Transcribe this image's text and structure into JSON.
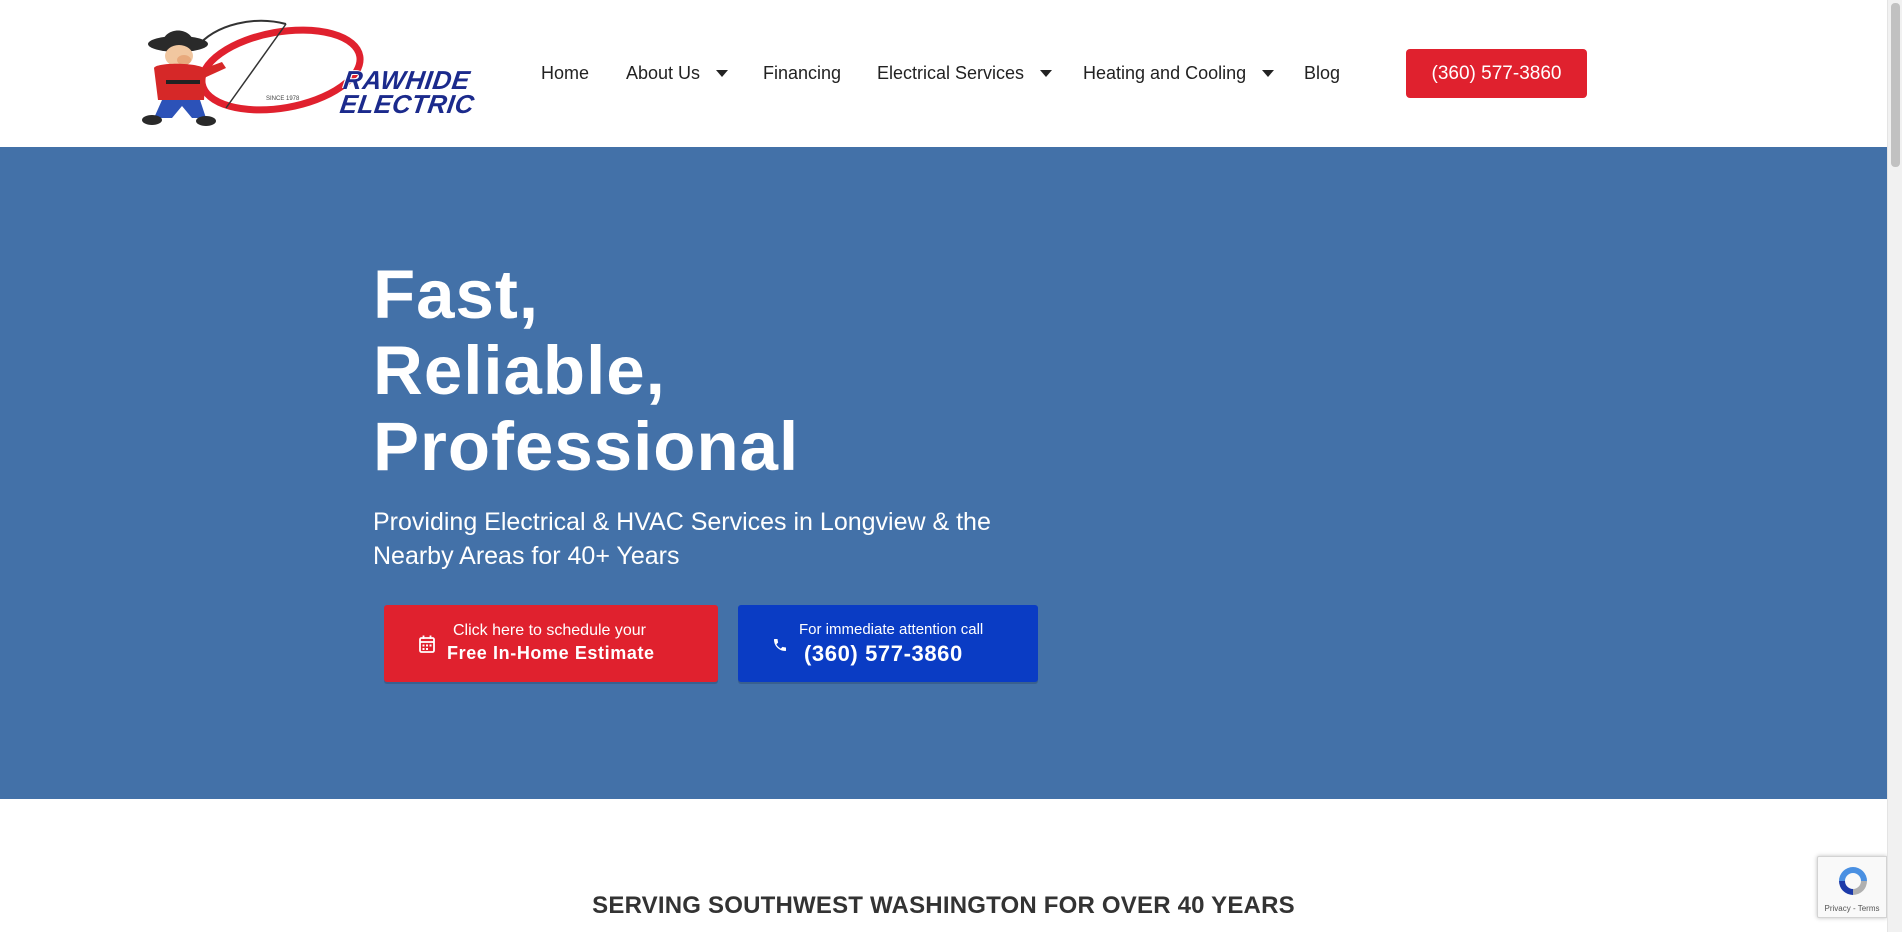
{
  "brand": {
    "logo_line1": "RAWHIDE",
    "logo_line2": "ELECTRIC",
    "logo_since": "SINCE 1978"
  },
  "nav": {
    "items": [
      {
        "label": "Home",
        "has_dropdown": false
      },
      {
        "label": "About Us",
        "has_dropdown": true
      },
      {
        "label": "Financing",
        "has_dropdown": false
      },
      {
        "label": "Electrical Services",
        "has_dropdown": true
      },
      {
        "label": "Heating and Cooling",
        "has_dropdown": true
      },
      {
        "label": "Blog",
        "has_dropdown": false
      }
    ],
    "phone_button": "(360) 577-3860"
  },
  "hero": {
    "title_lines": [
      "Fast,",
      "Reliable,",
      "Professional"
    ],
    "subtitle": "Providing Electrical & HVAC Services in Longview & the Nearby Areas for 40+ Years",
    "estimate_button": {
      "line1": "Click here to schedule your",
      "line2": "Free In-Home Estimate",
      "icon": "calendar-icon"
    },
    "call_button": {
      "line1": "For immediate attention call",
      "line2": "(360) 577-3860",
      "icon": "phone-icon"
    }
  },
  "section": {
    "heading": "SERVING SOUTHWEST WASHINGTON FOR OVER 40 YEARS"
  },
  "recaptcha": {
    "label": "Privacy - Terms"
  },
  "colors": {
    "hero_bg": "#4371a8",
    "accent_red": "#e0212e",
    "call_blue": "#0a3cc4",
    "logo_navy": "#1b2a8c"
  }
}
